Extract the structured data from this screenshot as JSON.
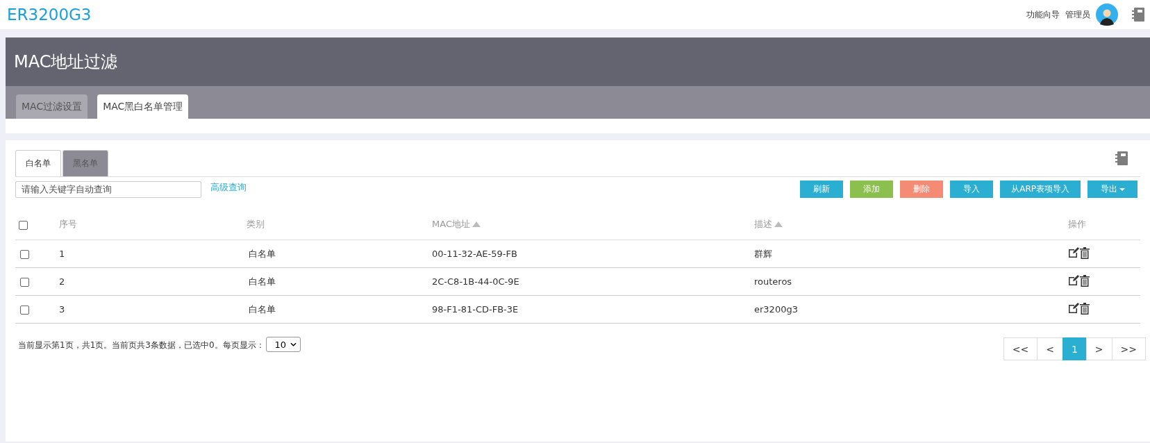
{
  "header": {
    "brand": "ER3200G3",
    "wizard_link": "功能向导",
    "user": "管理员"
  },
  "page": {
    "title": "MAC地址过滤",
    "tabs": [
      {
        "label": "MAC过滤设置",
        "selected": false
      },
      {
        "label": "MAC黑白名单管理",
        "selected": true
      }
    ]
  },
  "list_tabs": [
    {
      "label": "白名单",
      "selected": true
    },
    {
      "label": "黑名单",
      "selected": false
    }
  ],
  "search": {
    "placeholder": "请输入关键字自动查询",
    "advanced_link": "高级查询"
  },
  "buttons": [
    {
      "label": "刷新",
      "kind": "primary",
      "caret": false
    },
    {
      "label": "添加",
      "kind": "success",
      "caret": false
    },
    {
      "label": "删除",
      "kind": "danger",
      "caret": false
    },
    {
      "label": "导入",
      "kind": "primary",
      "caret": false
    },
    {
      "label": "从ARP表项导入",
      "kind": "primary",
      "caret": false
    },
    {
      "label": "导出",
      "kind": "primary",
      "caret": true
    }
  ],
  "table": {
    "select_all_checked": false,
    "columns": [
      {
        "label": "序号",
        "sortable": false
      },
      {
        "label": "类别",
        "sortable": false
      },
      {
        "label": "MAC地址",
        "sortable": true
      },
      {
        "label": "描述",
        "sortable": true
      },
      {
        "label": "操作",
        "sortable": false
      }
    ],
    "rows": [
      {
        "checked": false,
        "index": "1",
        "type": "白名单",
        "mac": "00-11-32-AE-59-FB",
        "description": "群辉"
      },
      {
        "checked": false,
        "index": "2",
        "type": "白名单",
        "mac": "2C-C8-1B-44-0C-9E",
        "description": "routeros"
      },
      {
        "checked": false,
        "index": "3",
        "type": "白名单",
        "mac": "98-F1-81-CD-FB-3E",
        "description": "er3200g3"
      }
    ]
  },
  "footer": {
    "summary": "当前显示第1页，共1页。当前页共3条数据，已选中0。每页显示：",
    "page_size": "10",
    "pagination": [
      {
        "label": "<<",
        "selected": false
      },
      {
        "label": "<",
        "selected": false
      },
      {
        "label": "1",
        "selected": true
      },
      {
        "label": ">",
        "selected": false
      },
      {
        "label": ">>",
        "selected": false
      }
    ]
  }
}
